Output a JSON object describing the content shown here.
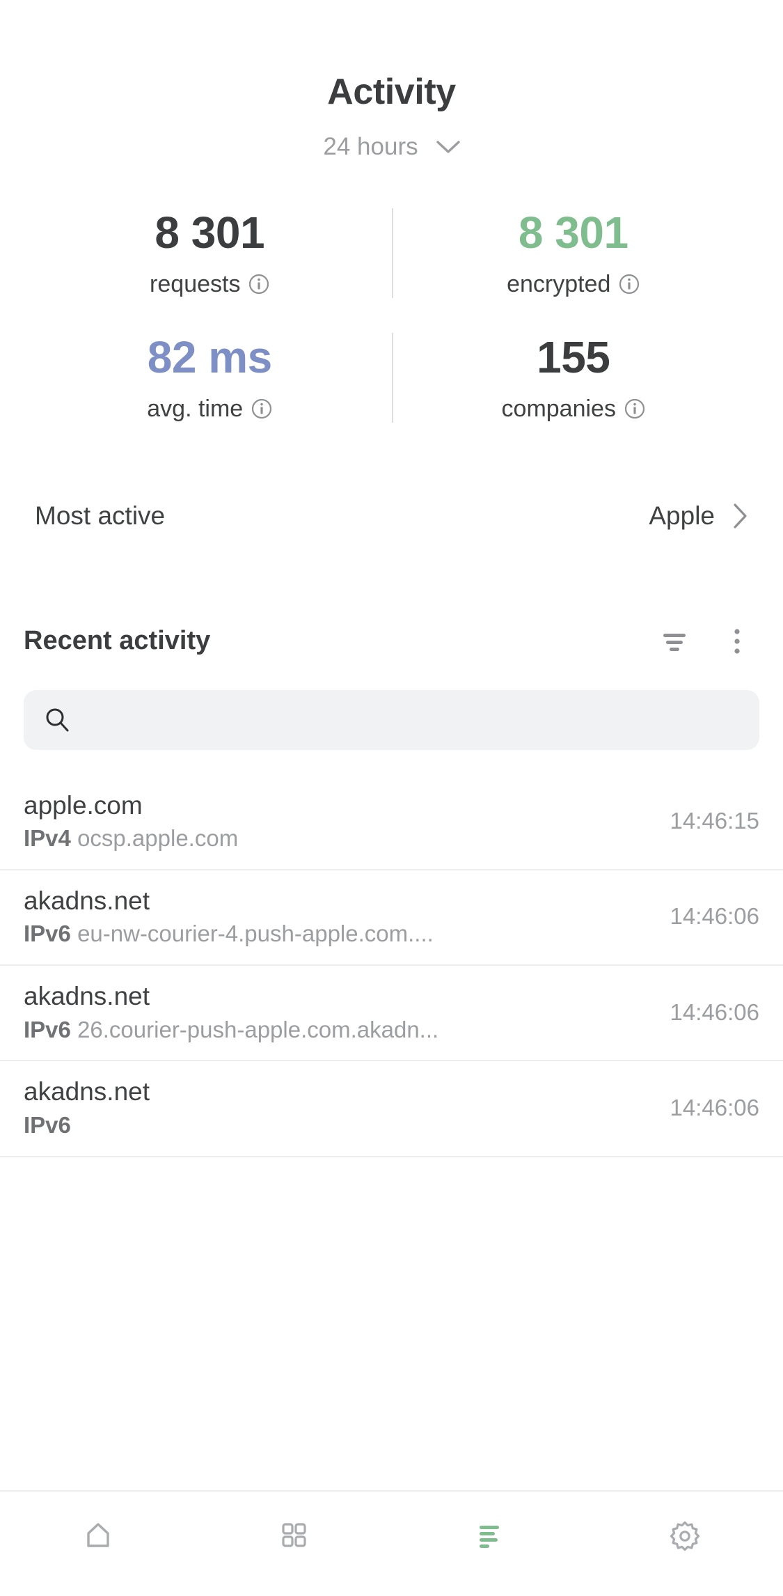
{
  "header": {
    "title": "Activity",
    "range_label": "24 hours",
    "chevron_icon": "chevron-down-icon"
  },
  "stats": {
    "rows": [
      {
        "cells": [
          {
            "value": "8 301",
            "label": "requests",
            "color": "#3b3d3f",
            "style": "dark",
            "info_icon": "info-icon"
          },
          {
            "value": "8 301",
            "label": "encrypted",
            "color": "#80bd8e",
            "style": "green",
            "info_icon": "info-icon"
          }
        ]
      },
      {
        "cells": [
          {
            "value": "82 ms",
            "label": "avg. time",
            "color": "#7d8fc4",
            "style": "blue",
            "info_icon": "info-icon"
          },
          {
            "value": "155",
            "label": "companies",
            "color": "#3b3d3f",
            "style": "dark",
            "info_icon": "info-icon"
          }
        ]
      }
    ]
  },
  "most_active": {
    "label": "Most active",
    "value": "Apple",
    "chevron_icon": "chevron-right-icon"
  },
  "recent": {
    "title": "Recent activity",
    "sort_icon": "sort-descending-icon",
    "menu_icon": "kebab-menu-icon"
  },
  "search": {
    "icon": "search-icon",
    "value": "",
    "placeholder": ""
  },
  "activity_list": [
    {
      "domain": "apple.com",
      "protocol": "IPv4",
      "host": "ocsp.apple.com",
      "time": "14:46:15"
    },
    {
      "domain": "akadns.net",
      "protocol": "IPv6",
      "host": "eu-nw-courier-4.push-apple.com....",
      "time": "14:46:06"
    },
    {
      "domain": "akadns.net",
      "protocol": "IPv6",
      "host": "26.courier-push-apple.com.akadn...",
      "time": "14:46:06"
    },
    {
      "domain": "akadns.net",
      "protocol": "IPv6",
      "host": "",
      "time": "14:46:06"
    }
  ],
  "bottom_nav": {
    "active_color": "#80bd8e",
    "inactive_color": "#a9abae",
    "items": [
      {
        "name": "home-icon",
        "active": false
      },
      {
        "name": "apps-grid-icon",
        "active": false
      },
      {
        "name": "activity-icon",
        "active": true
      },
      {
        "name": "settings-gear-icon",
        "active": false
      }
    ]
  }
}
